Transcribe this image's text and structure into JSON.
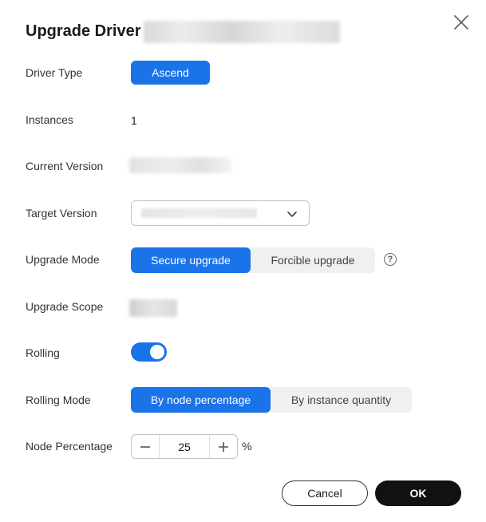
{
  "dialog": {
    "title": "Upgrade Driver"
  },
  "fields": {
    "driver_type": {
      "label": "Driver Type",
      "value": "Ascend"
    },
    "instances": {
      "label": "Instances",
      "value": "1"
    },
    "current_version": {
      "label": "Current Version"
    },
    "target_version": {
      "label": "Target Version"
    },
    "upgrade_mode": {
      "label": "Upgrade Mode",
      "options": [
        "Secure upgrade",
        "Forcible upgrade"
      ],
      "selected": "Secure upgrade",
      "help_icon": "question-circle-icon"
    },
    "upgrade_scope": {
      "label": "Upgrade Scope"
    },
    "rolling": {
      "label": "Rolling",
      "enabled": true
    },
    "rolling_mode": {
      "label": "Rolling Mode",
      "options": [
        "By node percentage",
        "By instance quantity"
      ],
      "selected": "By node percentage"
    },
    "node_percentage": {
      "label": "Node Percentage",
      "value": "25",
      "unit": "%"
    }
  },
  "footer": {
    "cancel_label": "Cancel",
    "ok_label": "OK"
  },
  "colors": {
    "accent": "#1a73e8",
    "ok_button": "#111111"
  }
}
